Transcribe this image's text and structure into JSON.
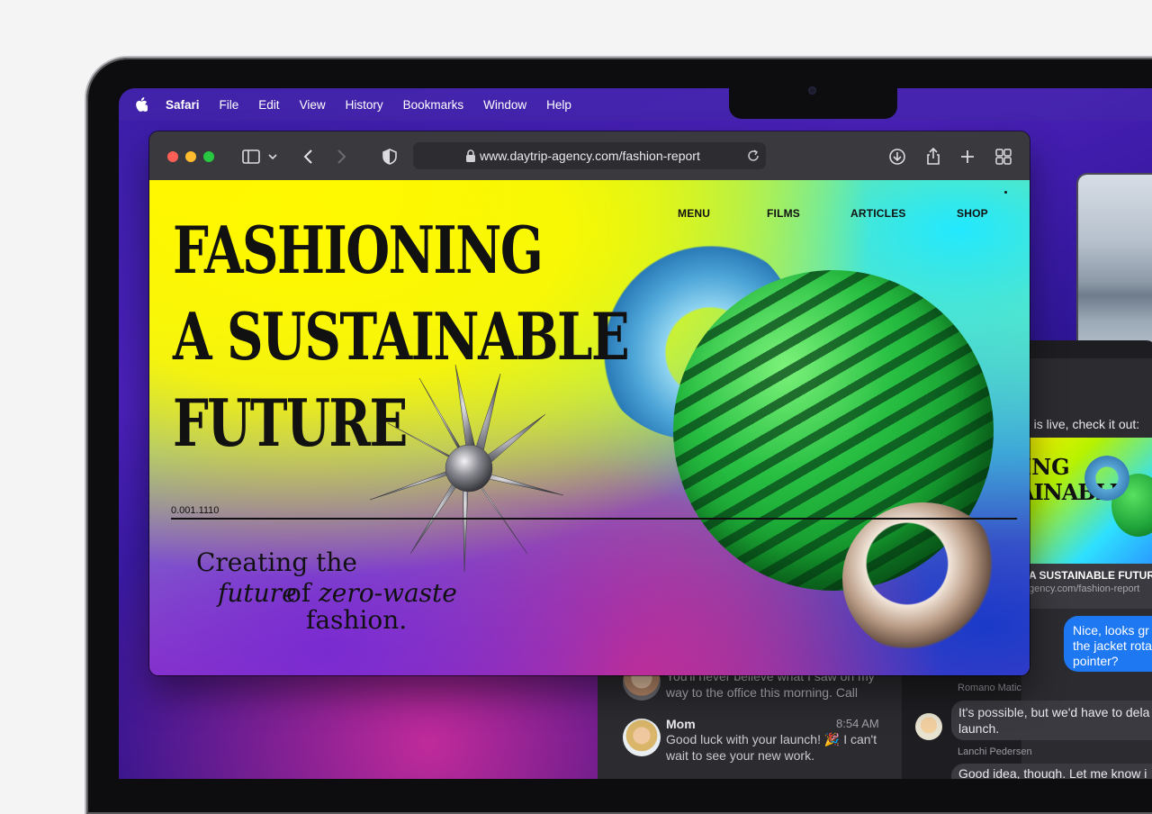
{
  "menubar": {
    "app": "Safari",
    "items": [
      "File",
      "Edit",
      "View",
      "History",
      "Bookmarks",
      "Window",
      "Help"
    ]
  },
  "safari": {
    "url": "www.daytrip-agency.com/fashion-report",
    "toolbar_icons": [
      "sidebar-icon",
      "chevron-down-icon",
      "back-icon",
      "forward-icon",
      "shield-icon",
      "lock-icon",
      "reload-icon",
      "download-icon",
      "share-icon",
      "plus-icon",
      "tab-overview-icon"
    ]
  },
  "webpage": {
    "nav": [
      "MENU",
      "FILMS",
      "ARTICLES",
      "SHOP"
    ],
    "headline": [
      "FASHIONING",
      "A SUSTAINABLE",
      "FUTURE"
    ],
    "code": "0.001.1110",
    "tagline": {
      "line1": "Creating the",
      "line2_a": "future",
      "line2_b": "of",
      "line2_c": "zero-waste",
      "line3": "fashion."
    }
  },
  "messages": {
    "preview_text": "n is live, check it out:",
    "link_card": {
      "title": "A SUSTAINABLE FUTUR",
      "domain": "gency.com/fashion-report",
      "img_line1": "ING",
      "img_line2": "AINABLE"
    },
    "blue_bubble": [
      "Nice, looks gr",
      "the jacket rota",
      "pointer?"
    ],
    "sender1": "Romano Matic",
    "reply1": [
      "It's possible, but we'd have to dela",
      "launch."
    ],
    "sender2": "Lanchi Pedersen",
    "reply2": "Good idea, though. Let me know i",
    "conversations": [
      {
        "name": "",
        "time": "",
        "preview": [
          "You'll never believe what I saw on my",
          "way to the office this morning. Call"
        ]
      },
      {
        "name": "Mom",
        "time": "8:54 AM",
        "preview": [
          "Good luck with your launch! 🎉 I can't",
          "wait to see your new work."
        ]
      }
    ]
  }
}
